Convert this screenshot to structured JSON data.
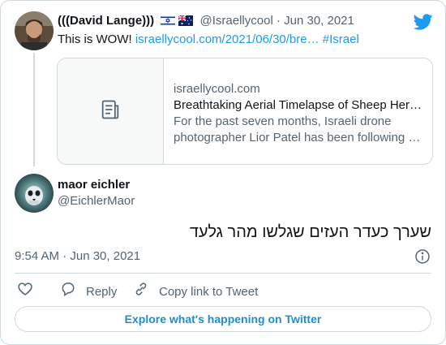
{
  "parent_tweet": {
    "display_name": "(((David Lange)))",
    "flags": [
      "israel-flag",
      "australia-flag"
    ],
    "handle": "@Israellycool",
    "separator": "·",
    "date": "Jun 30, 2021",
    "text_prefix": "This is WOW! ",
    "link_text": "israellycool.com/2021/06/30/bre…",
    "hashtag": "#Israel",
    "link_card": {
      "domain": "israellycool.com",
      "title": "Breathtaking Aerial Timelapse of Sheep Her…",
      "description": "For the past seven months, Israeli drone photographer Lior Patel has been following …",
      "thumbnail_icon": "document-icon"
    }
  },
  "reply_tweet": {
    "display_name": "maor eichler",
    "handle": "@EichlerMaor",
    "text": "שערך כעדר העזים שגלשו מהר גלעד",
    "timestamp": "9:54 AM · Jun 30, 2021"
  },
  "actions": {
    "like_icon": "heart-icon",
    "reply_label": "Reply",
    "copy_label": "Copy link to Tweet"
  },
  "explore_button": "Explore what's happening on Twitter",
  "colors": {
    "accent": "#1d9bf0",
    "secondary_text": "#536471",
    "border": "#cfd9de"
  }
}
